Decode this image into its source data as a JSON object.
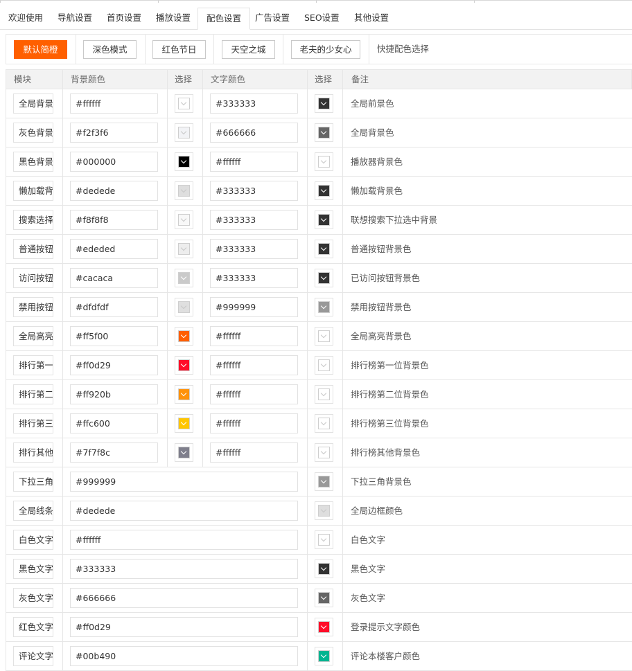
{
  "tabs": [
    {
      "label": "欢迎使用",
      "active": false
    },
    {
      "label": "导航设置",
      "active": false
    },
    {
      "label": "首页设置",
      "active": false
    },
    {
      "label": "播放设置",
      "active": false
    },
    {
      "label": "配色设置",
      "active": true
    },
    {
      "label": "广告设置",
      "active": false
    },
    {
      "label": "SEO设置",
      "active": false
    },
    {
      "label": "其他设置",
      "active": false
    }
  ],
  "presets": {
    "buttons": [
      {
        "label": "默认简橙",
        "primary": true
      },
      {
        "label": "深色模式",
        "primary": false
      },
      {
        "label": "红色节日",
        "primary": false
      },
      {
        "label": "天空之城",
        "primary": false
      },
      {
        "label": "老夫的少女心",
        "primary": false
      }
    ],
    "label": "快捷配色选择"
  },
  "table": {
    "headers": {
      "module": "模块",
      "bg_color": "背景颜色",
      "pick1": "选择",
      "text_color": "文字颜色",
      "pick2": "选择",
      "note": "备注"
    },
    "rows": [
      {
        "module": "全局背景",
        "bg": "#ffffff",
        "text": "#333333",
        "note": "全局前景色"
      },
      {
        "module": "灰色背景",
        "bg": "#f2f3f6",
        "text": "#666666",
        "note": "全局背景色"
      },
      {
        "module": "黑色背景",
        "bg": "#000000",
        "text": "#ffffff",
        "note": "播放器背景色"
      },
      {
        "module": "懒加载背",
        "bg": "#dedede",
        "text": "#333333",
        "note": "懒加载背景色"
      },
      {
        "module": "搜索选择",
        "bg": "#f8f8f8",
        "text": "#333333",
        "note": "联想搜索下拉选中背景"
      },
      {
        "module": "普通按钮",
        "bg": "#ededed",
        "text": "#333333",
        "note": "普通按钮背景色"
      },
      {
        "module": "访问按钮",
        "bg": "#cacaca",
        "text": "#333333",
        "note": "已访问按钮背景色"
      },
      {
        "module": "禁用按钮",
        "bg": "#dfdfdf",
        "text": "#999999",
        "note": "禁用按钮背景色"
      },
      {
        "module": "全局高亮",
        "bg": "#ff5f00",
        "text": "#ffffff",
        "note": "全局高亮背景色"
      },
      {
        "module": "排行第一",
        "bg": "#ff0d29",
        "text": "#ffffff",
        "note": "排行榜第一位背景色"
      },
      {
        "module": "排行第二",
        "bg": "#ff920b",
        "text": "#ffffff",
        "note": "排行榜第二位背景色"
      },
      {
        "module": "排行第三",
        "bg": "#ffc600",
        "text": "#ffffff",
        "note": "排行榜第三位背景色"
      },
      {
        "module": "排行其他",
        "bg": "#7f7f8c",
        "text": "#ffffff",
        "note": "排行榜其他背景色"
      },
      {
        "module": "下拉三角",
        "value": "#999999",
        "note": "下拉三角背景色"
      },
      {
        "module": "全局线条",
        "value": "#dedede",
        "note": "全局边框颜色"
      },
      {
        "module": "白色文字",
        "value": "#ffffff",
        "note": "白色文字"
      },
      {
        "module": "黑色文字",
        "value": "#333333",
        "note": "黑色文字"
      },
      {
        "module": "灰色文字",
        "value": "#666666",
        "note": "灰色文字"
      },
      {
        "module": "红色文字",
        "value": "#ff0d29",
        "note": "登录提示文字颜色"
      },
      {
        "module": "评论文字",
        "value": "#00b490",
        "note": "评论本楼客户颜色"
      }
    ]
  }
}
